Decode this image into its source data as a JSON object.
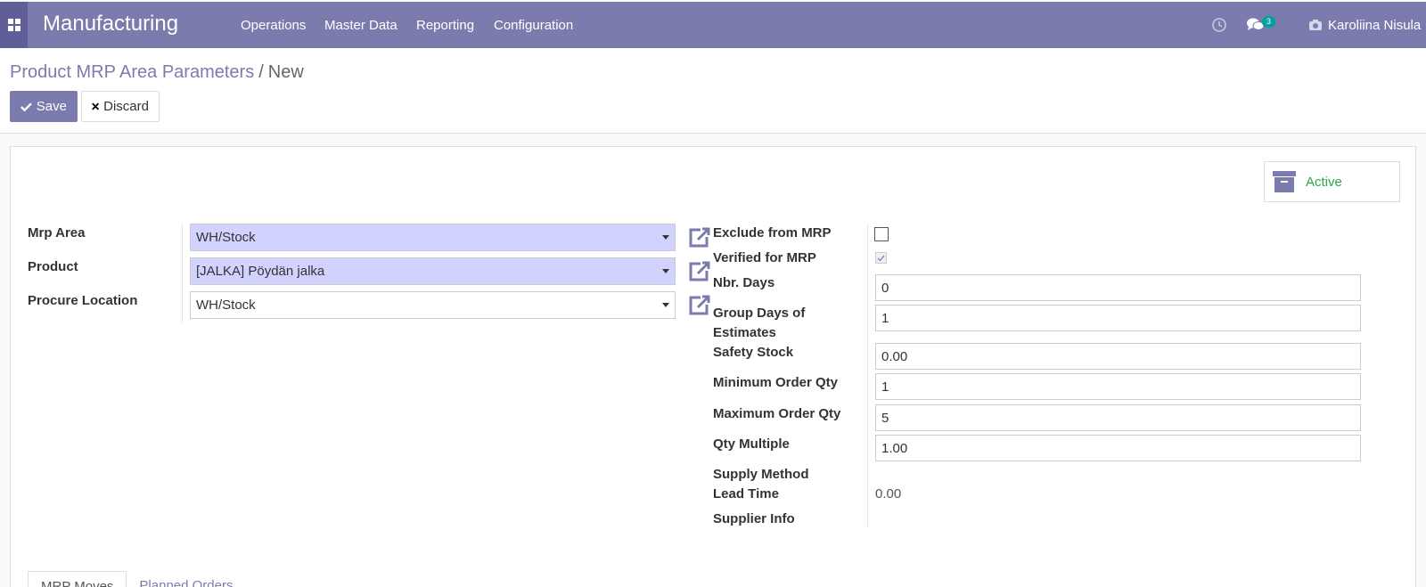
{
  "navbar": {
    "brand": "Manufacturing",
    "menu": [
      "Operations",
      "Master Data",
      "Reporting",
      "Configuration"
    ],
    "messages_count": "3",
    "user_name": "Karoliina Nisula"
  },
  "breadcrumb": {
    "parent": "Product MRP Area Parameters",
    "separator": "/",
    "current": "New"
  },
  "buttons": {
    "save": "Save",
    "discard": "Discard"
  },
  "status": {
    "active_label": "Active"
  },
  "form_left": {
    "mrp_area_label": "Mrp Area",
    "mrp_area_value": "WH/Stock",
    "product_label": "Product",
    "product_value": "[JALKA] Pöydän jalka",
    "procure_location_label": "Procure Location",
    "procure_location_value": "WH/Stock"
  },
  "form_right": {
    "exclude_label": "Exclude from MRP",
    "exclude_checked": false,
    "verified_label": "Verified for MRP",
    "verified_checked": true,
    "nbr_days_label": "Nbr. Days",
    "nbr_days_value": "0",
    "group_days_label_1": "Group Days of",
    "group_days_label_2": "Estimates",
    "group_days_value": "1",
    "safety_stock_label": "Safety Stock",
    "safety_stock_value": "0.00",
    "min_qty_label": "Minimum Order Qty",
    "min_qty_value": "1",
    "max_qty_label": "Maximum Order Qty",
    "max_qty_value": "5",
    "qty_multiple_label": "Qty Multiple",
    "qty_multiple_value": "1.00",
    "supply_method_label": "Supply Method",
    "lead_time_label": "Lead Time",
    "lead_time_value": "0.00",
    "supplier_info_label": "Supplier Info"
  },
  "tabs": [
    "MRP Moves",
    "Planned Orders"
  ],
  "colors": {
    "brand": "#7c7bad",
    "required_field": "#d2d2ff",
    "active_green": "#28a745"
  }
}
